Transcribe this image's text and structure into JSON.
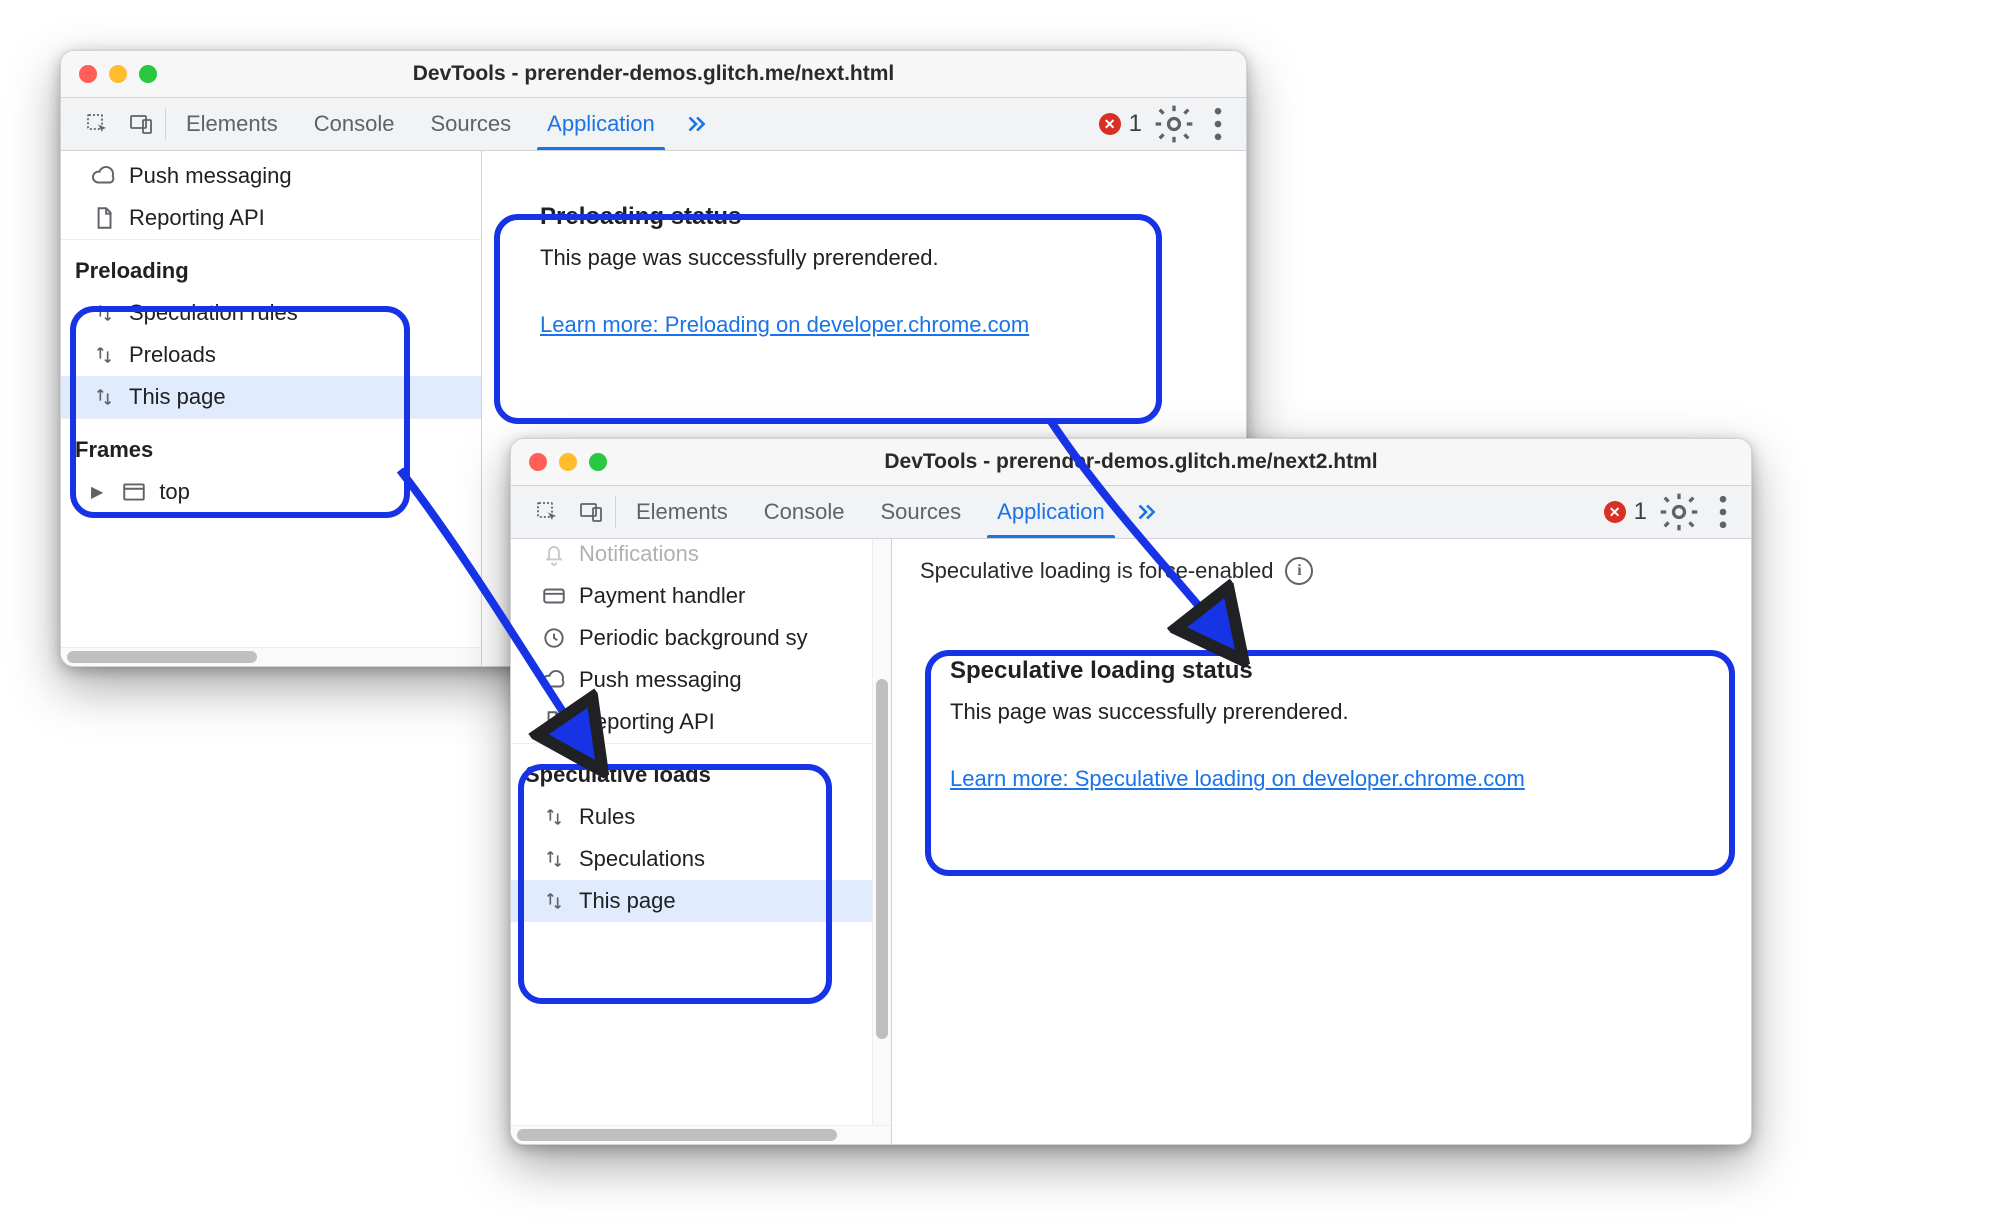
{
  "win1": {
    "title": "DevTools - prerender-demos.glitch.me/next.html",
    "tabs": [
      "Elements",
      "Console",
      "Sources",
      "Application"
    ],
    "active_tab": "Application",
    "errors": "1",
    "side_top": [
      {
        "icon": "cloud",
        "label": "Push messaging"
      },
      {
        "icon": "file",
        "label": "Reporting API"
      }
    ],
    "section1_title": "Preloading",
    "section1_items": [
      {
        "label": "Speculation rules"
      },
      {
        "label": "Preloads"
      },
      {
        "label": "This page",
        "selected": true
      }
    ],
    "section2_title": "Frames",
    "section2_items": [
      {
        "label": "top"
      }
    ],
    "status_title": "Preloading status",
    "status_text": "This page was successfully prerendered.",
    "status_link": "Learn more: Preloading on developer.chrome.com"
  },
  "win2": {
    "title": "DevTools - prerender-demos.glitch.me/next2.html",
    "tabs": [
      "Elements",
      "Console",
      "Sources",
      "Application"
    ],
    "active_tab": "Application",
    "errors": "1",
    "side_top": [
      {
        "icon": "bell",
        "label": "Notifications"
      },
      {
        "icon": "card",
        "label": "Payment handler"
      },
      {
        "icon": "clock",
        "label": "Periodic background sy"
      },
      {
        "icon": "cloud",
        "label": "Push messaging"
      },
      {
        "icon": "file",
        "label": "Reporting API"
      }
    ],
    "section1_title": "Speculative loads",
    "section1_items": [
      {
        "label": "Rules"
      },
      {
        "label": "Speculations"
      },
      {
        "label": "This page",
        "selected": true
      }
    ],
    "info_text": "Speculative loading is force-enabled",
    "status_title": "Speculative loading status",
    "status_text": "This page was successfully prerendered.",
    "status_link": "Learn more: Speculative loading on developer.chrome.com"
  }
}
